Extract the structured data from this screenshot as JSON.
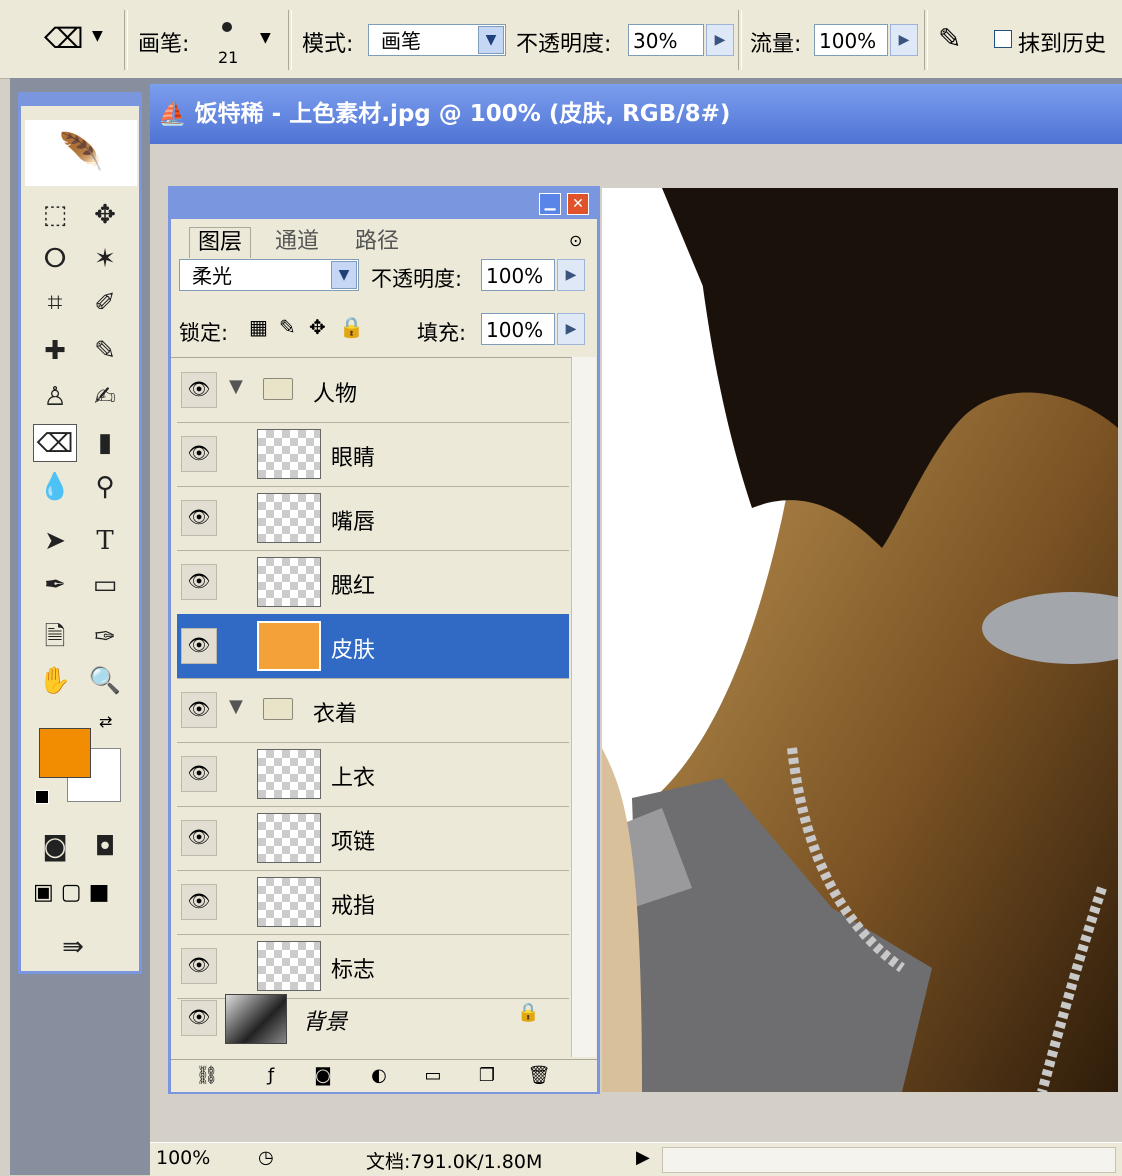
{
  "options_bar": {
    "brush_label": "画笔:",
    "brush_size": "21",
    "mode_label": "模式:",
    "mode_value": "画笔",
    "opacity_label": "不透明度:",
    "opacity_value": "30%",
    "flow_label": "流量:",
    "flow_value": "100%",
    "erase_history_label": "抹到历史"
  },
  "document": {
    "title": "饭特稀 - 上色素材.jpg @ 100% (皮肤, RGB/8#)",
    "zoom": "100%",
    "doc_info": "文档:791.0K/1.80M"
  },
  "layers_panel": {
    "tabs": [
      "图层",
      "通道",
      "路径"
    ],
    "blend_mode": "柔光",
    "opacity_label": "不透明度:",
    "opacity_value": "100%",
    "lock_label": "锁定:",
    "fill_label": "填充:",
    "fill_value": "100%",
    "layers": [
      {
        "name": "人物",
        "type": "group"
      },
      {
        "name": "眼睛",
        "type": "layer"
      },
      {
        "name": "嘴唇",
        "type": "layer"
      },
      {
        "name": "腮红",
        "type": "layer"
      },
      {
        "name": "皮肤",
        "type": "layer",
        "selected": true
      },
      {
        "name": "衣着",
        "type": "group"
      },
      {
        "name": "上衣",
        "type": "layer"
      },
      {
        "name": "项链",
        "type": "layer"
      },
      {
        "name": "戒指",
        "type": "layer"
      },
      {
        "name": "标志",
        "type": "layer"
      },
      {
        "name": "背景",
        "type": "background"
      }
    ]
  },
  "colors": {
    "foreground": "#f28c00",
    "background": "#ffffff",
    "selection": "#316ac5",
    "title_blue": "#4f73d4"
  }
}
